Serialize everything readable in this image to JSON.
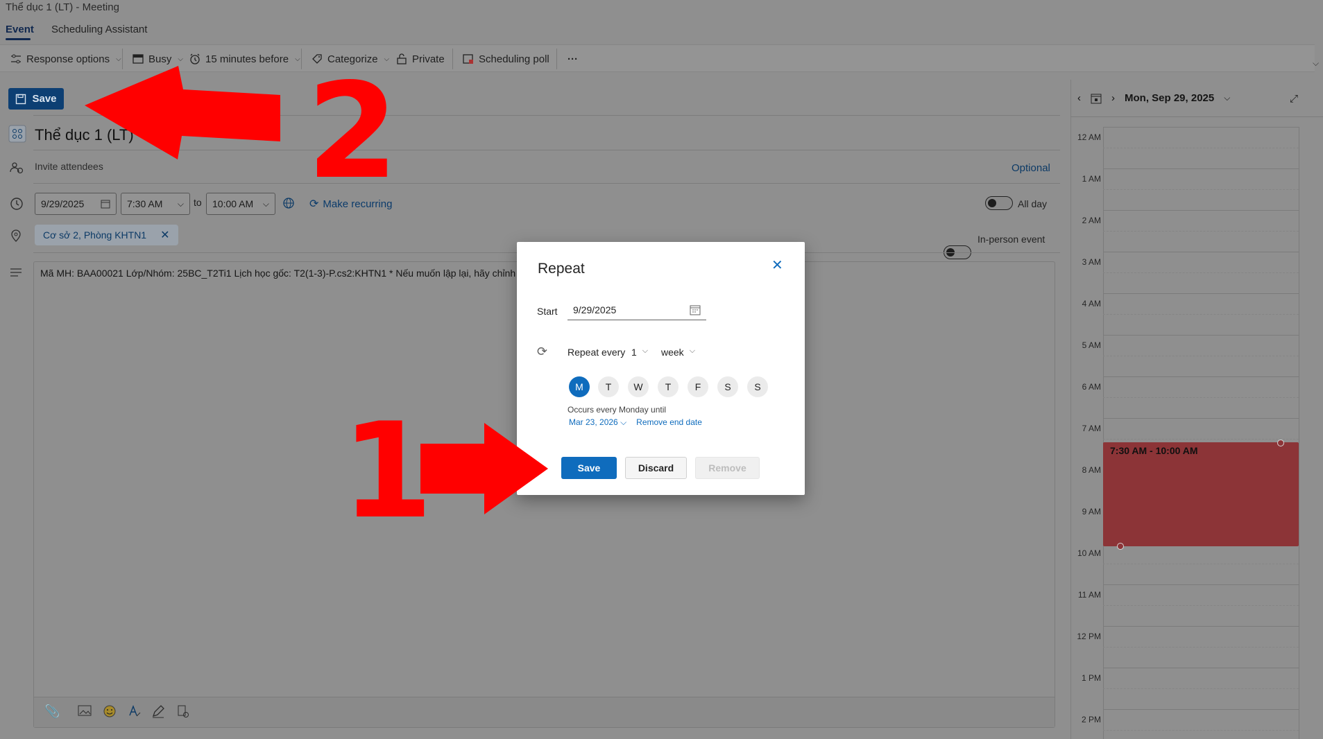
{
  "window": {
    "title": "Thể dục 1 (LT) - Meeting"
  },
  "tabs": [
    {
      "label": "Event"
    },
    {
      "label": "Scheduling Assistant"
    }
  ],
  "ribbon": {
    "response_options": "Response options",
    "busy": "Busy",
    "reminder": "15 minutes before",
    "categorize": "Categorize",
    "private": "Private",
    "scheduling_poll": "Scheduling poll",
    "more": "···"
  },
  "form": {
    "save_label": "Save",
    "title": "Thể dục 1 (LT)",
    "invite_placeholder": "Invite attendees",
    "optional_label": "Optional",
    "start_date": "9/29/2025",
    "start_time": "7:30 AM",
    "to_label": "to",
    "end_time": "10:00 AM",
    "make_recurring": "Make recurring",
    "all_day_label": "All day",
    "location_chip": "Cơ sở 2, Phòng KHTN1",
    "in_person_label": "In-person event",
    "body_text": "Mã MH: BAA00021 Lớp/Nhóm: 25BC_T2Ti1 Lịch học gốc: T2(1-3)-P.cs2:KHTN1 * Nếu muốn lập lại, hãy chỉnh \"Re"
  },
  "calendar": {
    "date_label": "Mon, Sep 29, 2025",
    "hours": [
      "12 AM",
      "1 AM",
      "2 AM",
      "3 AM",
      "4 AM",
      "5 AM",
      "6 AM",
      "7 AM",
      "8 AM",
      "9 AM",
      "10 AM",
      "11 AM",
      "12 PM",
      "1 PM",
      "2 PM"
    ],
    "event_label": "7:30 AM - 10:00 AM",
    "event_color": "#8c3437"
  },
  "dialog": {
    "title": "Repeat",
    "start_label": "Start",
    "start_value": "9/29/2025",
    "repeat_every_label": "Repeat every",
    "repeat_count": "1",
    "repeat_unit": "week",
    "days": [
      "M",
      "T",
      "W",
      "T",
      "F",
      "S",
      "S"
    ],
    "occurs_text": "Occurs every Monday until",
    "end_date": "Mar 23, 2026",
    "remove_end_date": "Remove end date",
    "save_label": "Save",
    "discard_label": "Discard",
    "remove_label": "Remove",
    "accent_color": "#0f6cbd"
  },
  "annotations": {
    "step1": "1",
    "step2": "2",
    "arrow_color": "#ff0000"
  }
}
